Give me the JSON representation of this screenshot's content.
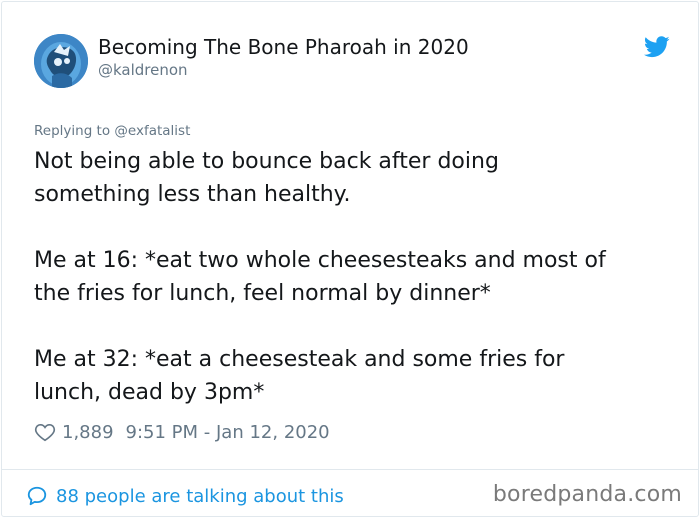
{
  "author": {
    "name": "Becoming The Bone Pharoah in 2020",
    "handle": "@kaldrenon",
    "avatar_icon": "avatar"
  },
  "brand_icon": "twitter-bird-icon",
  "brand_color": "#1da1f2",
  "reply_to": "Replying to @exfatalist",
  "tweet": {
    "line1": "Not being able to bounce back after doing",
    "line2": "something less than healthy.",
    "line3": "Me at 16: *eat two whole cheesesteaks and most of",
    "line4": "the fries for lunch, feel normal by dinner*",
    "line5": "Me at 32: *eat a cheesesteak and some fries for",
    "line6": "lunch, dead by 3pm*"
  },
  "meta": {
    "likes": "1,889",
    "timestamp": "9:51 PM - Jan 12, 2020"
  },
  "talking": {
    "label": "88 people are talking about this"
  },
  "watermark": "boredpanda.com",
  "colors": {
    "link": "#1b95e0",
    "secondary_text": "#657786"
  }
}
